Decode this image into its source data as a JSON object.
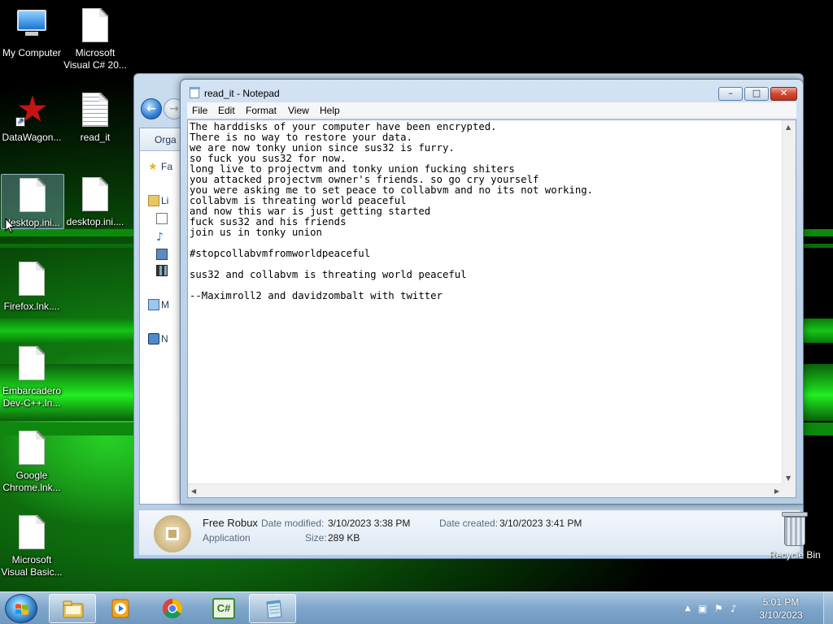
{
  "desktop": {
    "icons": [
      {
        "label_1": "My Computer",
        "label_2": "",
        "icon": "computer-icon"
      },
      {
        "label_1": "Microsoft",
        "label_2": "Visual C# 20...",
        "icon": "file-icon"
      },
      {
        "label_1": "DataWagon...",
        "label_2": "",
        "icon": "shortcut-star-icon"
      },
      {
        "label_1": "read_it",
        "label_2": "",
        "icon": "text-file-icon"
      },
      {
        "label_1": "desktop.ini...",
        "label_2": "",
        "icon": "file-icon"
      },
      {
        "label_1": "desktop.ini....",
        "label_2": "",
        "icon": "file-icon"
      },
      {
        "label_1": "Firefox.lnk....",
        "label_2": "",
        "icon": "file-icon"
      },
      {
        "label_1": "Embarcadero",
        "label_2": "Dev-C++.ln...",
        "icon": "file-icon"
      },
      {
        "label_1": "Google",
        "label_2": "Chrome.lnk...",
        "icon": "file-icon"
      },
      {
        "label_1": "Microsoft",
        "label_2": "Visual Basic...",
        "icon": "file-icon"
      }
    ],
    "recycle_bin": "Recycle Bin"
  },
  "explorer": {
    "toolbar_organize": "Orga",
    "sidebar": {
      "favorites": "Fa",
      "libraries": "Li",
      "computer": "M",
      "network": "N"
    },
    "details": {
      "name": "Free Robux",
      "type": "Application",
      "modified_label": "Date modified:",
      "modified_value": "3/10/2023 3:38 PM",
      "created_label": "Date created:",
      "created_value": "3/10/2023 3:41 PM",
      "size_label": "Size:",
      "size_value": "289 KB"
    }
  },
  "notepad": {
    "title": "read_it - Notepad",
    "menu": [
      "File",
      "Edit",
      "Format",
      "View",
      "Help"
    ],
    "content": "The harddisks of your computer have been encrypted.\nThere is no way to restore your data.\nwe are now tonky union since sus32 is furry.\nso fuck you sus32 for now.\nlong live to projectvm and tonky union fucking shiters\nyou attacked projectvm owner's friends. so go cry yourself\nyou were asking me to set peace to collabvm and no its not working.\ncollabvm is threating world peaceful\nand now this war is just getting started\nfuck sus32 and his friends\njoin us in tonky union\n\n#stopcollabvmfromworldpeaceful\n\nsus32 and collabvm is threating world peaceful\n\n--Maximroll2 and davidzombalt with twitter",
    "caption_buttons": {
      "minimize": "–",
      "maximize": "□",
      "close": "✕"
    }
  },
  "taskbar": {
    "pinned": [
      {
        "name": "explorer",
        "icon": "folder-icon",
        "active": true
      },
      {
        "name": "media-player",
        "icon": "media-player-icon",
        "active": false
      },
      {
        "name": "chrome",
        "icon": "chrome-icon",
        "active": false
      },
      {
        "name": "csharp",
        "icon": "csharp-icon",
        "active": false,
        "glyph": "C#"
      },
      {
        "name": "notepad",
        "icon": "notepad-icon",
        "active": true
      }
    ],
    "tray_glyphs": {
      "show_hidden": "▲",
      "network": "▣",
      "flag": "⚑",
      "volume": "♪"
    },
    "clock": {
      "time": "5:01 PM",
      "date": "3/10/2023"
    }
  },
  "colors": {
    "accent_green": "#17c417",
    "close_red": "#cf4a33",
    "taskbar_blue": "#7fa6cb"
  }
}
